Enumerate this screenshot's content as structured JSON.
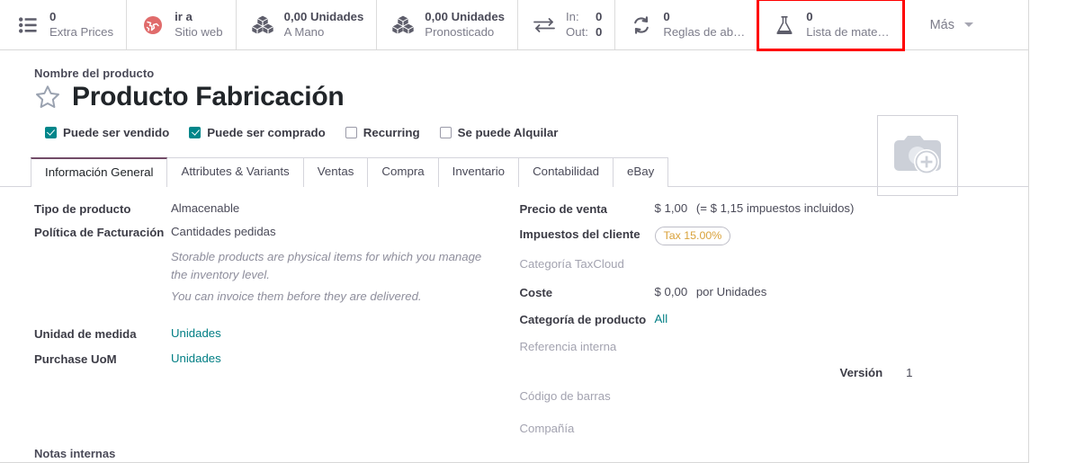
{
  "statbar": {
    "buttons": [
      {
        "icon": "list-icon",
        "value": "0",
        "label": "Extra Prices",
        "type": "value-label",
        "highlighted": false
      },
      {
        "icon": "globe-icon",
        "value": "ir a",
        "label": "Sitio web",
        "type": "value-label",
        "highlighted": false
      },
      {
        "icon": "cubes-icon",
        "value": "0,00 Unidades",
        "label": "A Mano",
        "type": "value-label",
        "highlighted": false
      },
      {
        "icon": "cubes-icon",
        "value": "0,00 Unidades",
        "label": "Pronosticado",
        "type": "value-label",
        "highlighted": false
      },
      {
        "icon": "exchange-icon",
        "type": "kv-rows",
        "rows": [
          {
            "key": "In:",
            "val": "0"
          },
          {
            "key": "Out:",
            "val": "0"
          }
        ],
        "highlighted": false
      },
      {
        "icon": "refresh-icon",
        "value": "0",
        "label": "Reglas de ab…",
        "type": "value-label",
        "highlighted": false
      },
      {
        "icon": "flask-icon",
        "value": "0",
        "label": "Lista de mate…",
        "type": "value-label",
        "highlighted": true
      }
    ],
    "more_label": "Más",
    "highlight_color": "#ff0000"
  },
  "title": {
    "caption": "Nombre del producto",
    "name": "Producto Fabricación",
    "star_icon": "star-outline-icon"
  },
  "checkboxes": [
    {
      "label": "Puede ser vendido",
      "checked": true
    },
    {
      "label": "Puede ser comprado",
      "checked": true
    },
    {
      "label": "Recurring",
      "checked": false
    },
    {
      "label": "Se puede Alquilar",
      "checked": false
    }
  ],
  "image": {
    "icon": "camera-add-icon"
  },
  "tabs": [
    {
      "label": "Información General",
      "active": true
    },
    {
      "label": "Attributes & Variants",
      "active": false
    },
    {
      "label": "Ventas",
      "active": false
    },
    {
      "label": "Compra",
      "active": false
    },
    {
      "label": "Inventario",
      "active": false
    },
    {
      "label": "Contabilidad",
      "active": false
    },
    {
      "label": "eBay",
      "active": false
    }
  ],
  "left_fields": {
    "product_type": {
      "label": "Tipo de producto",
      "value": "Almacenable"
    },
    "invoicing_policy": {
      "label": "Política de Facturación",
      "value": "Cantidades pedidas"
    },
    "helper_line1": "Storable products are physical items for which you manage the inventory level.",
    "helper_line2": "You can invoice them before they are delivered.",
    "uom": {
      "label": "Unidad de medida",
      "value": "Unidades"
    },
    "purchase_uom": {
      "label": "Purchase UoM",
      "value": "Unidades"
    }
  },
  "right_fields": {
    "sales_price": {
      "label": "Precio de venta",
      "value": "$ 1,00",
      "suffix": "(= $ 1,15 impuestos incluidos)"
    },
    "customer_taxes": {
      "label": "Impuestos del cliente",
      "tag": "Tax 15.00%"
    },
    "taxcloud": {
      "label": "Categoría TaxCloud",
      "value": ""
    },
    "cost": {
      "label": "Coste",
      "value": "$ 0,00",
      "suffix": "por Unidades"
    },
    "product_category": {
      "label": "Categoría de producto",
      "value": "All"
    },
    "internal_ref": {
      "label": "Referencia interna",
      "value": ""
    },
    "barcode": {
      "label": "Código de barras",
      "value": ""
    },
    "company": {
      "label": "Compañía",
      "value": ""
    },
    "version": {
      "label": "Versión",
      "value": "1"
    }
  },
  "notes_label": "Notas internas",
  "colors": {
    "accent_purple": "#714B67",
    "checkbox_teal": "#00868A",
    "link_teal": "#017E84",
    "tag_orange": "#D9A23B",
    "globe_red": "#E06B6B",
    "muted_text": "#A3A3B0"
  }
}
